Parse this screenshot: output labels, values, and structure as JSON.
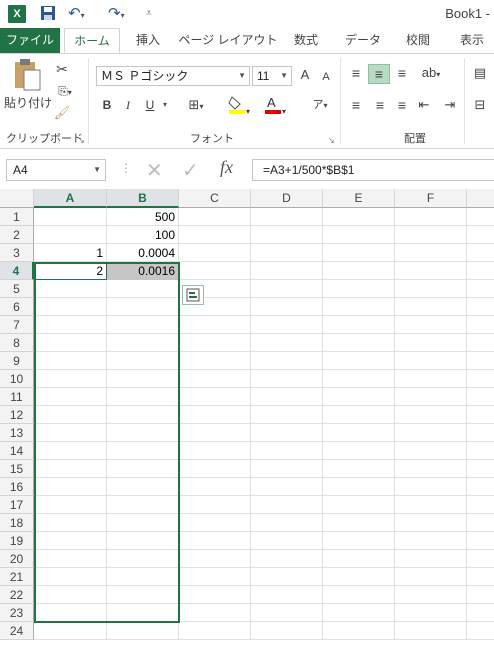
{
  "app": {
    "title": "Book1 -"
  },
  "tabs": [
    "ファイル",
    "ホーム",
    "挿入",
    "ページ レイアウト",
    "数式",
    "データ",
    "校閲",
    "表示"
  ],
  "ribbon": {
    "clipboard": {
      "paste_label": "貼り付け",
      "group_label": "クリップボード"
    },
    "font": {
      "font_name": "ＭＳ Ｐゴシック",
      "font_size": "11",
      "group_label": "フォント",
      "grow": "A",
      "shrink": "A",
      "bold": "B",
      "italic": "I",
      "underline": "U"
    },
    "alignment": {
      "group_label": "配置"
    }
  },
  "formula_bar": {
    "name_box": "A4",
    "fx": "fx",
    "formula": "=A3+1/500*$B$1"
  },
  "columns": [
    "A",
    "B",
    "C",
    "D",
    "E",
    "F"
  ],
  "rows": [
    "1",
    "2",
    "3",
    "4",
    "5",
    "6",
    "7",
    "8",
    "9",
    "10",
    "11",
    "12",
    "13",
    "14",
    "15",
    "16",
    "17",
    "18",
    "19",
    "20",
    "21",
    "22",
    "23",
    "24"
  ],
  "cells": {
    "B1": "500",
    "B2": "100",
    "A3": "1",
    "B3": "0.0004",
    "A4": "2",
    "B4": "0.0016"
  },
  "colors": {
    "accent": "#217346",
    "selection_fill": "#c6c6c6"
  }
}
